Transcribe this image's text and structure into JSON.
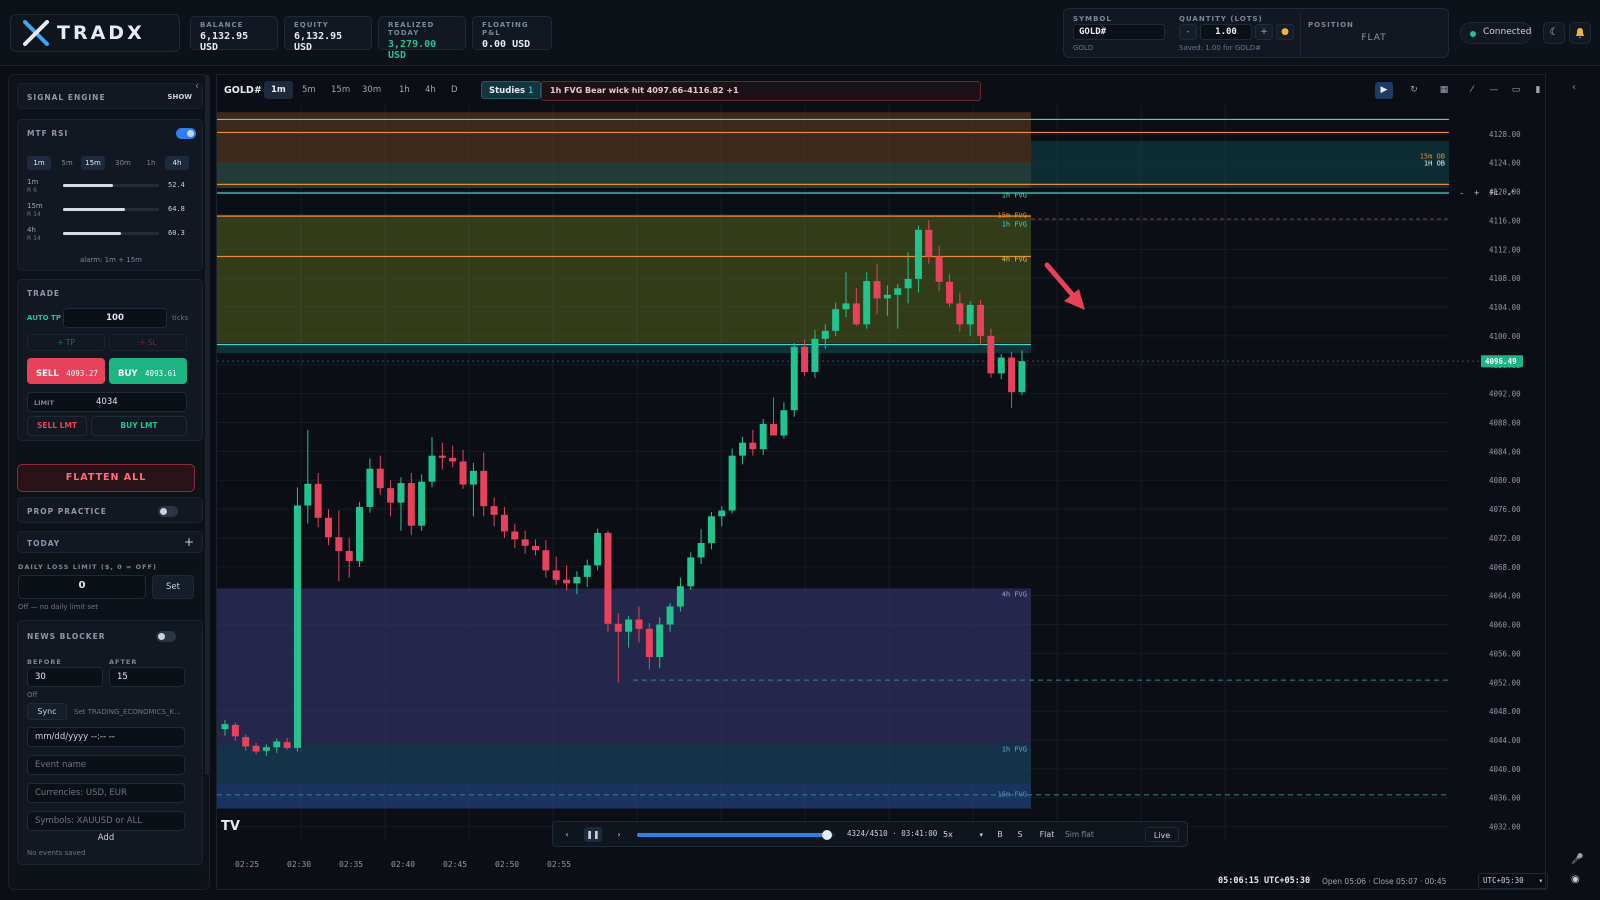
{
  "header": {
    "brand": "TRADX",
    "stats": [
      {
        "label": "BALANCE",
        "value": "6,132.95 USD"
      },
      {
        "label": "EQUITY",
        "value": "6,132.95 USD"
      },
      {
        "label": "REALIZED TODAY",
        "value": "3,279.00 USD"
      },
      {
        "label": "FLOATING P&L",
        "value": "0.00 USD"
      }
    ],
    "symbol_label": "SYMBOL",
    "symbol_value": "GOLD#",
    "symbol_sub": "GOLD",
    "quantity_label": "QUANTITY (LOTS)",
    "quantity_value": "1.00",
    "quantity_saved": "Saved: 1.00 for GOLD#",
    "position_label": "POSITION",
    "position_value": "FLAT",
    "connection": "Connected"
  },
  "sidebar": {
    "signal_engine": {
      "title": "SIGNAL ENGINE",
      "button": "SHOW"
    },
    "mtf_rsi": {
      "title": "MTF RSI",
      "enabled": true,
      "timeframes": [
        {
          "label": "1m",
          "active": true
        },
        {
          "label": "5m",
          "active": false
        },
        {
          "label": "15m",
          "active": true
        },
        {
          "label": "30m",
          "active": false
        },
        {
          "label": "1h",
          "active": false
        },
        {
          "label": "4h",
          "active": true
        }
      ],
      "rows": [
        {
          "tf": "1m",
          "sub": "R 6",
          "value": "52.4",
          "level": 0.524
        },
        {
          "tf": "15m",
          "sub": "R 14",
          "value": "64.8",
          "level": 0.648
        },
        {
          "tf": "4h",
          "sub": "R 14",
          "value": "60.3",
          "level": 0.603
        }
      ],
      "alarm": "alarm: 1m + 15m"
    },
    "trade": {
      "title": "TRADE",
      "auto_tp_label": "AUTO TP",
      "auto_tp_value": "100",
      "ticks_label": "ticks",
      "tp_button": "+ TP",
      "sl_button": "+ SL",
      "sell_label": "SELL",
      "sell_price": "4093.27",
      "buy_label": "BUY",
      "buy_price": "4093.61",
      "limit_label": "LIMIT",
      "limit_value": "4034",
      "sell_lmt": "SELL LMT",
      "buy_lmt": "BUY LMT"
    },
    "flatten_all": "FLATTEN ALL",
    "prop_practice": {
      "title": "PROP PRACTICE",
      "enabled": false
    },
    "today": {
      "title": "TODAY",
      "add": "+"
    },
    "daily_loss": {
      "title": "DAILY LOSS LIMIT ($, 0 = OFF)",
      "value": "0",
      "set": "Set",
      "note": "Off — no daily limit set"
    },
    "news_blocker": {
      "title": "NEWS BLOCKER",
      "enabled": false,
      "before_label": "BEFORE",
      "before_value": "30",
      "after_label": "AFTER",
      "after_value": "15",
      "status": "Off",
      "sync": "Sync",
      "sync_note": "Set TRADING_ECONOMICS_K...",
      "date_placeholder": "mm/dd/yyyy --:-- --",
      "event_placeholder": "Event name",
      "currencies_placeholder": "Currencies: USD, EUR",
      "symbols_placeholder": "Symbols: XAUUSD or ALL",
      "add": "Add",
      "empty": "No events saved"
    }
  },
  "chart": {
    "symbol": "GOLD#",
    "timeframes": [
      {
        "label": "1m",
        "active": true
      },
      {
        "label": "5m",
        "active": false
      },
      {
        "label": "15m",
        "active": false
      },
      {
        "label": "30m",
        "active": false
      },
      {
        "label": "1h",
        "active": false
      },
      {
        "label": "4h",
        "active": false
      },
      {
        "label": "D",
        "active": false
      }
    ],
    "studies_label": "Studies",
    "studies_count": "1",
    "alert": "1h FVG Bear wick hit 4097.66–4116.82 +1",
    "fit_label": "Fit",
    "current_price": "4096.49",
    "zone_labels": [
      "1h FVG",
      "15m FVG",
      "1h FVG",
      "4h FVG",
      "4h FVG",
      "1h FVG",
      "15m FVG",
      "15m OB",
      "1H OB"
    ],
    "replay": {
      "progress": "4324/4510",
      "time": "03:41:00",
      "speed": "5x",
      "b": "B",
      "s": "S",
      "flat": "Flat",
      "sim": "Sim flat",
      "live": "Live",
      "position": 0.96
    },
    "clock": "05:06:15 UTC+05:30",
    "session": "Open 05:06 · Close 05:07 · 00:45",
    "timezone": "UTC+05:30"
  },
  "chart_data": {
    "type": "candlestick",
    "ylim": [
      4030,
      4132
    ],
    "yticks": [
      "4128.00",
      "4124.00",
      "4120.00",
      "4116.00",
      "4112.00",
      "4108.00",
      "4104.00",
      "4100.00",
      "4096.00",
      "4092.00",
      "4088.00",
      "4084.00",
      "4080.00",
      "4076.00",
      "4072.00",
      "4068.00",
      "4064.00",
      "4060.00",
      "4056.00",
      "4052.00",
      "4048.00",
      "4044.00",
      "4040.00",
      "4036.00",
      "4032.00"
    ],
    "xticks": [
      "02:25",
      "02:30",
      "02:35",
      "02:40",
      "02:45",
      "02:50",
      "02:55"
    ],
    "candles": [
      [
        4045.5,
        4046.8,
        4044.6,
        4046.2
      ],
      [
        4046.1,
        4046.4,
        4043.9,
        4044.5
      ],
      [
        4044.4,
        4044.8,
        4042.5,
        4043.1
      ],
      [
        4043.2,
        4043.6,
        4042.0,
        4042.4
      ],
      [
        4042.5,
        4043.4,
        4041.8,
        4043.0
      ],
      [
        4043.0,
        4044.2,
        4042.2,
        4043.8
      ],
      [
        4043.7,
        4044.3,
        4042.6,
        4042.9
      ],
      [
        4042.9,
        4079.0,
        4042.4,
        4076.5
      ],
      [
        4076.5,
        4087.0,
        4074.0,
        4079.5
      ],
      [
        4079.5,
        4081.0,
        4073.5,
        4074.8
      ],
      [
        4074.8,
        4076.0,
        4071.0,
        4072.1
      ],
      [
        4072.1,
        4075.8,
        4066.0,
        4070.2
      ],
      [
        4070.2,
        4072.0,
        4066.5,
        4068.8
      ],
      [
        4068.8,
        4077.0,
        4068.0,
        4076.3
      ],
      [
        4076.3,
        4083.0,
        4075.5,
        4081.6
      ],
      [
        4081.6,
        4083.4,
        4078.0,
        4078.9
      ],
      [
        4078.9,
        4080.0,
        4075.0,
        4076.9
      ],
      [
        4076.9,
        4080.4,
        4073.0,
        4079.6
      ],
      [
        4079.6,
        4081.0,
        4072.4,
        4073.7
      ],
      [
        4073.7,
        4080.8,
        4073.0,
        4079.8
      ],
      [
        4079.8,
        4086.0,
        4079.0,
        4083.4
      ],
      [
        4083.4,
        4085.2,
        4081.5,
        4083.1
      ],
      [
        4083.1,
        4084.8,
        4081.8,
        4082.6
      ],
      [
        4082.6,
        4084.2,
        4078.8,
        4079.4
      ],
      [
        4079.4,
        4082.4,
        4075.0,
        4081.3
      ],
      [
        4081.3,
        4083.8,
        4075.0,
        4076.4
      ],
      [
        4076.4,
        4077.6,
        4073.6,
        4075.2
      ],
      [
        4075.2,
        4076.3,
        4072.0,
        4072.9
      ],
      [
        4072.9,
        4074.0,
        4070.6,
        4071.8
      ],
      [
        4071.8,
        4073.0,
        4069.8,
        4070.9
      ],
      [
        4070.9,
        4071.8,
        4069.6,
        4070.3
      ],
      [
        4070.3,
        4071.7,
        4066.5,
        4067.5
      ],
      [
        4067.5,
        4069.4,
        4065.5,
        4066.2
      ],
      [
        4066.2,
        4068.2,
        4064.7,
        4065.7
      ],
      [
        4065.7,
        4067.4,
        4064.2,
        4066.6
      ],
      [
        4066.6,
        4069.0,
        4065.2,
        4068.2
      ],
      [
        4068.2,
        4073.3,
        4067.5,
        4072.7
      ],
      [
        4072.7,
        4073.0,
        4059.0,
        4060.1
      ],
      [
        4060.1,
        4061.6,
        4052.0,
        4059.0
      ],
      [
        4059.0,
        4061.2,
        4056.8,
        4060.7
      ],
      [
        4060.7,
        4062.5,
        4057.5,
        4059.4
      ],
      [
        4059.4,
        4060.2,
        4053.8,
        4055.5
      ],
      [
        4055.5,
        4061.0,
        4054.0,
        4060.0
      ],
      [
        4060.0,
        4063.0,
        4059.0,
        4062.5
      ],
      [
        4062.5,
        4066.5,
        4061.8,
        4065.3
      ],
      [
        4065.3,
        4070.0,
        4064.8,
        4069.3
      ],
      [
        4069.3,
        4073.2,
        4068.4,
        4071.3
      ],
      [
        4071.3,
        4075.6,
        4070.4,
        4075.0
      ],
      [
        4075.0,
        4076.4,
        4073.6,
        4075.8
      ],
      [
        4075.8,
        4084.4,
        4075.4,
        4083.4
      ],
      [
        4083.4,
        4086.0,
        4082.2,
        4085.2
      ],
      [
        4085.2,
        4087.0,
        4083.4,
        4084.3
      ],
      [
        4084.3,
        4088.5,
        4083.5,
        4087.8
      ],
      [
        4087.8,
        4091.5,
        4087.0,
        4086.2
      ],
      [
        4086.2,
        4090.8,
        4085.8,
        4089.7
      ],
      [
        4089.7,
        4099.0,
        4088.8,
        4098.5
      ],
      [
        4098.5,
        4099.5,
        4094.4,
        4095.0
      ],
      [
        4095.0,
        4100.8,
        4094.2,
        4099.6
      ],
      [
        4099.6,
        4101.6,
        4098.2,
        4100.7
      ],
      [
        4100.7,
        4104.6,
        4100.0,
        4103.7
      ],
      [
        4103.7,
        4108.8,
        4102.6,
        4104.5
      ],
      [
        4104.5,
        4106.6,
        4101.4,
        4101.6
      ],
      [
        4101.6,
        4108.8,
        4101.0,
        4107.6
      ],
      [
        4107.6,
        4110.0,
        4103.0,
        4105.2
      ],
      [
        4105.2,
        4107.0,
        4102.8,
        4105.7
      ],
      [
        4105.7,
        4107.2,
        4101.0,
        4106.6
      ],
      [
        4106.6,
        4111.6,
        4104.5,
        4107.9
      ],
      [
        4107.9,
        4115.3,
        4106.0,
        4114.7
      ],
      [
        4114.7,
        4116.0,
        4110.0,
        4111.0
      ],
      [
        4111.0,
        4112.5,
        4106.2,
        4107.5
      ],
      [
        4107.5,
        4108.6,
        4104.0,
        4104.5
      ],
      [
        4104.5,
        4106.0,
        4100.6,
        4101.6
      ],
      [
        4101.6,
        4104.8,
        4100.0,
        4104.3
      ],
      [
        4104.3,
        4105.0,
        4098.8,
        4100.0
      ],
      [
        4100.0,
        4101.0,
        4094.2,
        4094.8
      ],
      [
        4094.8,
        4097.5,
        4094.0,
        4097.0
      ],
      [
        4097.0,
        4097.8,
        4090.0,
        4092.2
      ],
      [
        4092.2,
        4098.0,
        4091.8,
        4096.5
      ]
    ]
  },
  "colors": {
    "up": "#22c38e",
    "down": "#e8415c",
    "accent": "#2f80ed",
    "orange": "#e98a2b",
    "cyan": "#3fd6d0"
  }
}
